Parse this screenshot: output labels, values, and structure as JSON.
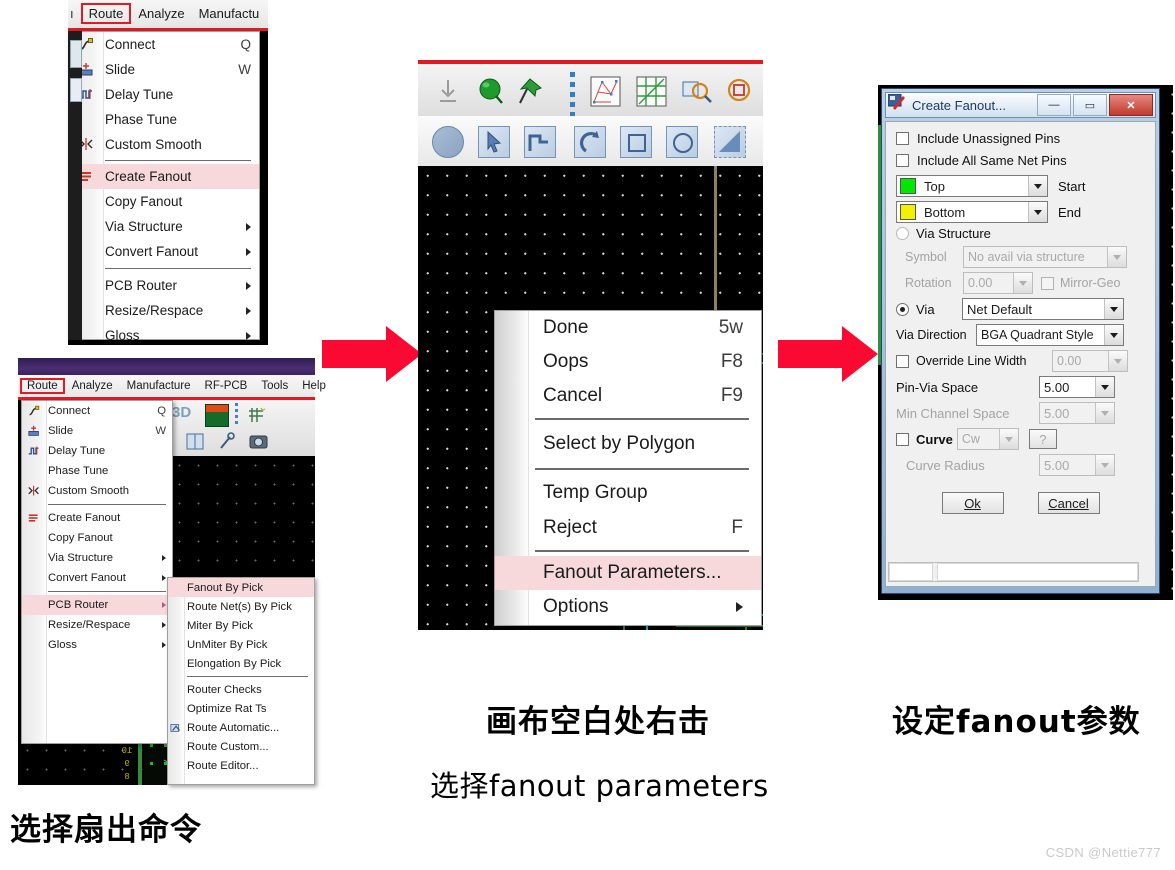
{
  "panel_top_left": {
    "name": "route-menu-open",
    "menubar": [
      {
        "label": "Route",
        "selected": true
      },
      {
        "label": "Analyze",
        "selected": false
      },
      {
        "label": "Manufactu",
        "selected": false
      }
    ],
    "menu_items": [
      {
        "label": "Connect",
        "accel": "Q",
        "icon": "connect-icon",
        "highlight": false,
        "submenu": false
      },
      {
        "label": "Slide",
        "accel": "W",
        "icon": "slide-icon",
        "highlight": false,
        "submenu": false
      },
      {
        "label": "Delay Tune",
        "accel": "",
        "icon": "delay-tune-icon",
        "highlight": false,
        "submenu": false
      },
      {
        "label": "Phase Tune",
        "accel": "",
        "icon": "",
        "highlight": false,
        "submenu": false
      },
      {
        "label": "Custom Smooth",
        "accel": "",
        "icon": "custom-smooth-icon",
        "highlight": false,
        "submenu": false
      },
      {
        "separator": true
      },
      {
        "label": "Create Fanout",
        "accel": "",
        "icon": "create-fanout-icon",
        "highlight": true,
        "submenu": false
      },
      {
        "label": "Copy Fanout",
        "accel": "",
        "icon": "",
        "highlight": false,
        "submenu": false
      },
      {
        "label": "Via Structure",
        "accel": "",
        "icon": "",
        "highlight": false,
        "submenu": true
      },
      {
        "label": "Convert Fanout",
        "accel": "",
        "icon": "",
        "highlight": false,
        "submenu": true
      },
      {
        "separator": true
      },
      {
        "label": "PCB Router",
        "accel": "",
        "icon": "",
        "highlight": false,
        "submenu": true
      },
      {
        "label": "Resize/Respace",
        "accel": "",
        "icon": "",
        "highlight": false,
        "submenu": true
      },
      {
        "label": "Gloss",
        "accel": "",
        "icon": "",
        "highlight": false,
        "submenu": true
      }
    ]
  },
  "panel_bottom_left": {
    "name": "pcb-router-submenu-open",
    "menubar": [
      {
        "label": "Route",
        "selected": true
      },
      {
        "label": "Analyze",
        "selected": false
      },
      {
        "label": "Manufacture",
        "selected": false
      },
      {
        "label": "RF-PCB",
        "selected": false
      },
      {
        "label": "Tools",
        "selected": false
      },
      {
        "label": "Help",
        "selected": false
      }
    ],
    "menu_items": [
      {
        "label": "Connect",
        "accel": "Q",
        "icon": "connect-icon",
        "highlight": false,
        "submenu": false
      },
      {
        "label": "Slide",
        "accel": "W",
        "icon": "slide-icon",
        "highlight": false,
        "submenu": false
      },
      {
        "label": "Delay Tune",
        "accel": "",
        "icon": "delay-tune-icon",
        "highlight": false,
        "submenu": false
      },
      {
        "label": "Phase Tune",
        "accel": "",
        "icon": "",
        "highlight": false,
        "submenu": false
      },
      {
        "label": "Custom Smooth",
        "accel": "",
        "icon": "custom-smooth-icon",
        "highlight": false,
        "submenu": false
      },
      {
        "separator": true
      },
      {
        "label": "Create Fanout",
        "accel": "",
        "icon": "create-fanout-icon",
        "highlight": false,
        "submenu": false
      },
      {
        "label": "Copy Fanout",
        "accel": "",
        "icon": "",
        "highlight": false,
        "submenu": false
      },
      {
        "label": "Via Structure",
        "accel": "",
        "icon": "",
        "highlight": false,
        "submenu": true
      },
      {
        "label": "Convert Fanout",
        "accel": "",
        "icon": "",
        "highlight": false,
        "submenu": true
      },
      {
        "separator": true
      },
      {
        "label": "PCB Router",
        "accel": "",
        "icon": "",
        "highlight": true,
        "submenu": true
      },
      {
        "label": "Resize/Respace",
        "accel": "",
        "icon": "",
        "highlight": false,
        "submenu": true
      },
      {
        "label": "Gloss",
        "accel": "",
        "icon": "",
        "highlight": false,
        "submenu": true
      }
    ],
    "submenu_items": [
      {
        "label": "Fanout By Pick",
        "icon": "",
        "highlight": true
      },
      {
        "label": "Route Net(s) By Pick",
        "icon": "",
        "highlight": false
      },
      {
        "label": "Miter By Pick",
        "icon": "",
        "highlight": false
      },
      {
        "label": "UnMiter By Pick",
        "icon": "",
        "highlight": false
      },
      {
        "label": "Elongation By Pick",
        "icon": "",
        "highlight": false
      },
      {
        "separator": true
      },
      {
        "label": "Router Checks",
        "icon": "",
        "highlight": false
      },
      {
        "label": "Optimize Rat Ts",
        "icon": "",
        "highlight": false
      },
      {
        "label": "Route Automatic...",
        "icon": "route-automatic-icon",
        "highlight": false
      },
      {
        "label": "Route Custom...",
        "icon": "",
        "highlight": false
      },
      {
        "label": "Route Editor...",
        "icon": "",
        "highlight": false
      }
    ]
  },
  "panel_middle": {
    "name": "canvas-context-menu",
    "context_menu": [
      {
        "label": "Done",
        "accel": "5w",
        "highlight": false,
        "submenu": false
      },
      {
        "label": "Oops",
        "accel": "F8",
        "highlight": false,
        "submenu": false
      },
      {
        "label": "Cancel",
        "accel": "F9",
        "highlight": false,
        "submenu": false
      },
      {
        "separator": true
      },
      {
        "label": "Select by Polygon",
        "accel": "",
        "highlight": false,
        "submenu": false
      },
      {
        "separator": true
      },
      {
        "label": "Temp Group",
        "accel": "",
        "highlight": false,
        "submenu": false
      },
      {
        "label": "Reject",
        "accel": "F",
        "highlight": false,
        "submenu": false
      },
      {
        "separator": true
      },
      {
        "label": "Fanout Parameters...",
        "accel": "",
        "highlight": true,
        "submenu": false
      },
      {
        "label": "Options",
        "accel": "",
        "highlight": false,
        "submenu": true
      }
    ]
  },
  "dialog": {
    "name": "create-fanout-dialog",
    "title": "Create Fanout...",
    "window_buttons": {
      "minimize": "—",
      "maximize": "▭",
      "close": "✕"
    },
    "checkboxes": [
      {
        "label": "Include Unassigned Pins",
        "checked": false,
        "disabled": false
      },
      {
        "label": "Include All Same Net Pins",
        "checked": false,
        "disabled": false
      }
    ],
    "start_layer": {
      "value": "Top",
      "side_label": "Start",
      "color": "#00E800"
    },
    "end_layer": {
      "value": "Bottom",
      "side_label": "End",
      "color": "#F2F200"
    },
    "via_structure_radio": {
      "label": "Via Structure",
      "selected": false
    },
    "symbol": {
      "label": "Symbol",
      "value": "No avail via structure",
      "disabled": true
    },
    "rotation": {
      "label": "Rotation",
      "value": "0.00",
      "disabled": true
    },
    "mirror_geo": {
      "label": "Mirror-Geo",
      "checked": false,
      "disabled": true
    },
    "via_radio": {
      "label": "Via",
      "selected": true,
      "value": "Net Default"
    },
    "via_direction": {
      "label": "Via Direction",
      "value": "BGA Quadrant Style"
    },
    "override_line_width": {
      "label": "Override Line Width",
      "checked": false,
      "value": "0.00",
      "disabled": true
    },
    "pin_via_space": {
      "label": "Pin-Via Space",
      "value": "5.00",
      "disabled": false
    },
    "min_channel_space": {
      "label": "Min Channel Space",
      "value": "5.00",
      "disabled": true
    },
    "curve": {
      "label": "Curve",
      "checked": false,
      "value": "Cw",
      "help": "?",
      "disabled": true
    },
    "curve_radius": {
      "label": "Curve Radius",
      "value": "5.00",
      "disabled": true
    },
    "ok_button": "Ok",
    "cancel_button": "Cancel"
  },
  "captions": {
    "left": "选择扇出命令",
    "middle_line1": "画布空白处右击",
    "middle_line2": "选择fanout parameters",
    "right": "设定fanout参数"
  },
  "watermark": "CSDN @Nettie777",
  "colors": {
    "highlight": "#f7d9dc",
    "arrow_red": "#FA0A32",
    "menubar_select_border": "#e01b24",
    "canvas_black": "#000000",
    "title_blue": "#8fb2d2"
  }
}
